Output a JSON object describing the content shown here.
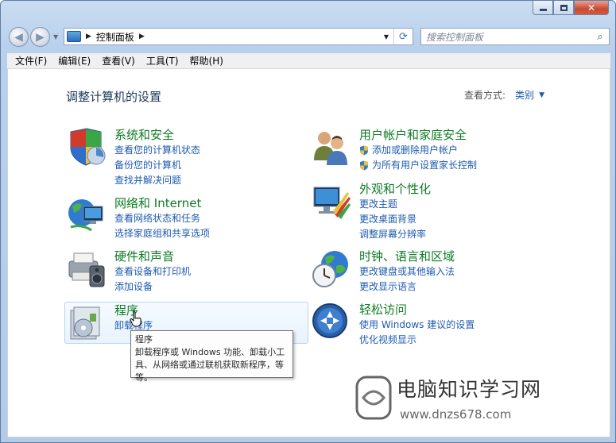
{
  "window": {
    "controls": {
      "minimize": "minimize",
      "maximize": "maximize",
      "close": "✕"
    }
  },
  "address": {
    "breadcrumb": "控制面板",
    "search_placeholder": "搜索控制面板"
  },
  "menu": [
    {
      "label": "文件(F)"
    },
    {
      "label": "编辑(E)"
    },
    {
      "label": "查看(V)"
    },
    {
      "label": "工具(T)"
    },
    {
      "label": "帮助(H)"
    }
  ],
  "page": {
    "heading": "调整计算机的设置",
    "view_by_label": "查看方式:",
    "view_by_value": "类别"
  },
  "categories": [
    {
      "title": "系统和安全",
      "icon": "system-security-icon",
      "links": [
        "查看您的计算机状态",
        "备份您的计算机",
        "查找并解决问题"
      ]
    },
    {
      "title": "网络和 Internet",
      "icon": "network-internet-icon",
      "links": [
        "查看网络状态和任务",
        "选择家庭组和共享选项"
      ]
    },
    {
      "title": "硬件和声音",
      "icon": "hardware-sound-icon",
      "links": [
        "查看设备和打印机",
        "添加设备"
      ]
    },
    {
      "title": "程序",
      "icon": "programs-icon",
      "links": [
        "卸载程序"
      ]
    },
    {
      "title": "用户帐户和家庭安全",
      "icon": "user-accounts-icon",
      "links": [
        "添加或删除用户帐户",
        "为所有用户设置家长控制"
      ]
    },
    {
      "title": "外观和个性化",
      "icon": "appearance-icon",
      "links": [
        "更改主题",
        "更改桌面背景",
        "调整屏幕分辨率"
      ]
    },
    {
      "title": "时钟、语言和区域",
      "icon": "clock-language-icon",
      "links": [
        "更改键盘或其他输入法",
        "更改显示语言"
      ]
    },
    {
      "title": "轻松访问",
      "icon": "ease-of-access-icon",
      "links": [
        "使用 Windows 建议的设置",
        "优化视频显示"
      ]
    }
  ],
  "tooltip": {
    "title": "程序",
    "body": "卸载程序或 Windows 功能、卸载小工具、从网络或通过联机获取新程序，等等。"
  },
  "watermark": {
    "name": "电脑知识学习网",
    "url": "www.dnzs678.com"
  },
  "colors": {
    "category_title": "#0e7a23",
    "link": "#1e5bae",
    "heading": "#1e395b"
  }
}
